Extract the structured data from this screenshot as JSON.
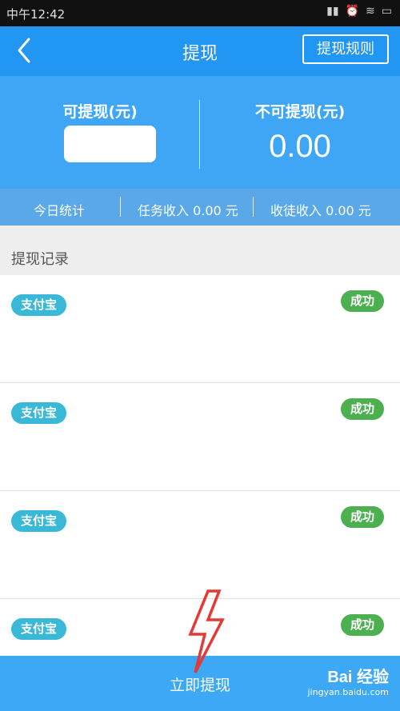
{
  "status_bar": {
    "time": "中午12:42",
    "icons": [
      "signal-icon",
      "alarm-icon",
      "wifi-icon",
      "battery-icon"
    ]
  },
  "header": {
    "title": "提现",
    "rules_button": "提现规则",
    "back_icon": "chevron-left-icon"
  },
  "balance": {
    "withdrawable_label": "可提现(元)",
    "withdrawable_value": "",
    "non_withdrawable_label": "不可提现(元)",
    "non_withdrawable_value": "0.00"
  },
  "stats": {
    "today": "今日统计",
    "task_income": "任务收入 0.00 元",
    "disciple_income": "收徒收入 0.00 元"
  },
  "records": {
    "title": "提现记录",
    "items": [
      {
        "method": "支付宝",
        "status": "成功"
      },
      {
        "method": "支付宝",
        "status": "成功"
      },
      {
        "method": "支付宝",
        "status": "成功"
      },
      {
        "method": "支付宝",
        "status": "成功"
      }
    ]
  },
  "footer": {
    "withdraw_button": "立即提现"
  },
  "watermark": {
    "main": "Bai 经验",
    "sub": "jingyan.baidu.com"
  },
  "colors": {
    "primary": "#2196f3",
    "panel": "#3ea6f5",
    "alipay_badge": "#39b8d8",
    "success_badge": "#4caf50",
    "annotation": "#e53935"
  }
}
